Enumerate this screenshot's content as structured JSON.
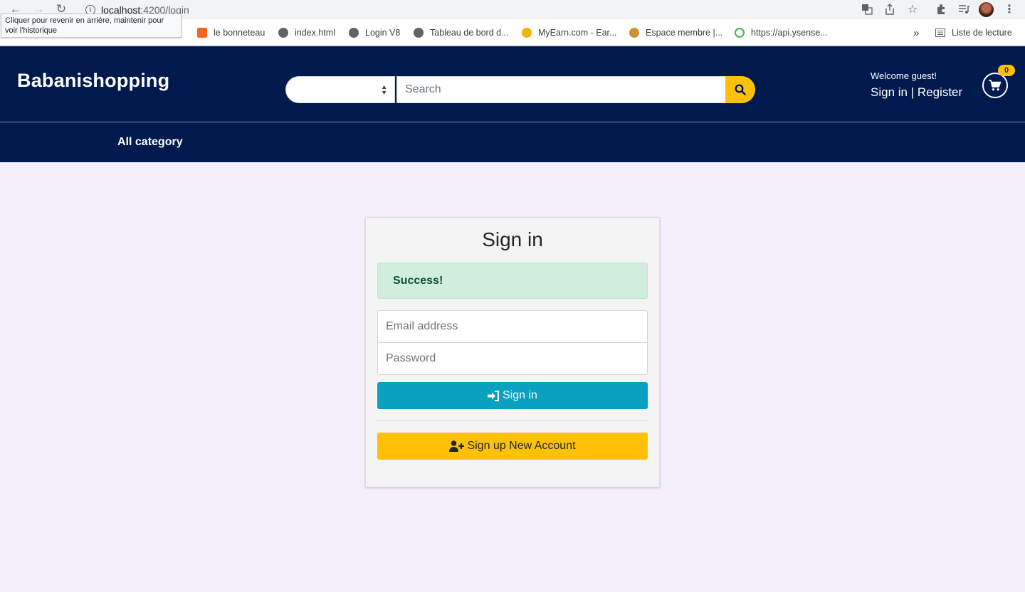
{
  "browser": {
    "url_host": "localhost",
    "url_path": ":4200/login",
    "tooltip": "Cliquer pour revenir en arrière, maintenir pour voir l'historique",
    "bookmarks": [
      {
        "label": "le bonneteau",
        "icon": "xampp-icon",
        "color": "#f26522"
      },
      {
        "label": "index.html",
        "icon": "globe-icon",
        "color": "#5f6368"
      },
      {
        "label": "Login V8",
        "icon": "globe-icon",
        "color": "#5f6368"
      },
      {
        "label": "Tableau de bord d...",
        "icon": "globe-icon",
        "color": "#5f6368"
      },
      {
        "label": "MyEarn.com - Ear...",
        "icon": "myearn-icon",
        "color": "#f5b400"
      },
      {
        "label": "Espace membre |...",
        "icon": "espace-icon",
        "color": "#c89432"
      },
      {
        "label": "https://api.ysense...",
        "icon": "ysense-icon",
        "color": "#4caf50"
      }
    ],
    "reading_list": "Liste de lecture",
    "overflow": "»"
  },
  "header": {
    "brand": "Babanishopping",
    "category_select": "",
    "search_placeholder": "Search",
    "welcome": "Welcome guest!",
    "sign_in": "Sign in",
    "separator": "|",
    "register": "Register",
    "cart_count": "0"
  },
  "subnav": {
    "all_category": "All category"
  },
  "login": {
    "title": "Sign in",
    "alert": "Success!",
    "email_placeholder": "Email address",
    "password_placeholder": "Password",
    "signin_button": "Sign in",
    "signup_button": "Sign up New Account"
  },
  "colors": {
    "navy": "#001a4d",
    "accent_yellow": "#ffc107",
    "signin_teal": "#0aa1c0",
    "success_bg": "#d1eedc",
    "page_bg": "#f3f0fc"
  }
}
